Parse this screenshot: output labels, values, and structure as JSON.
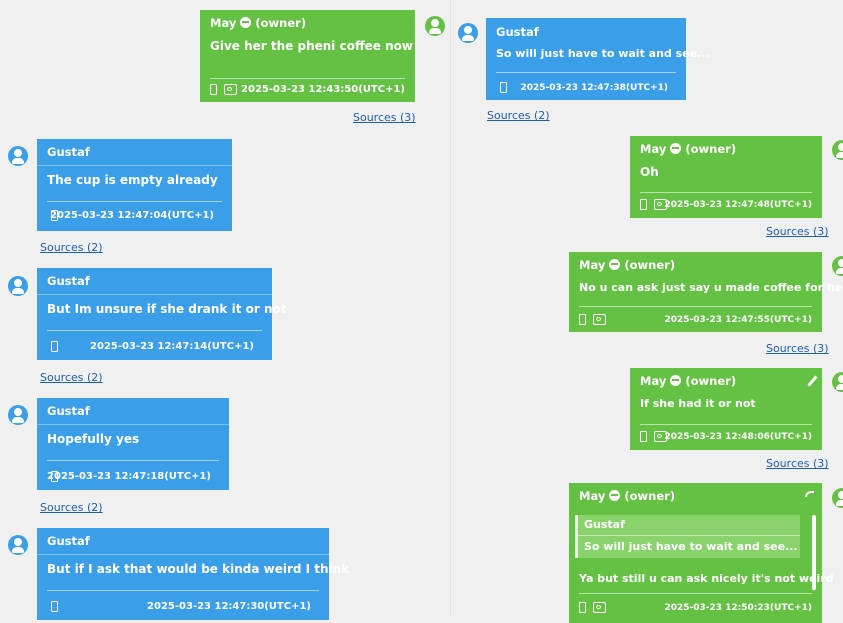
{
  "left": [
    {
      "id": "m1",
      "author": "May",
      "role": "(owner)",
      "text": "Give her the pheni coffee now",
      "timestamp": "2025-03-23 12:43:50(UTC+1)",
      "sources": "Sources (3)",
      "side": "right",
      "color": "green"
    },
    {
      "id": "m2",
      "author": "Gustaf",
      "text": "The cup is empty already",
      "timestamp": "2025-03-23 12:47:04(UTC+1)",
      "sources": "Sources (2)",
      "side": "left",
      "color": "blue"
    },
    {
      "id": "m3",
      "author": "Gustaf",
      "text": "But Im unsure if she drank it or not",
      "timestamp": "2025-03-23 12:47:14(UTC+1)",
      "sources": "Sources (2)",
      "side": "left",
      "color": "blue"
    },
    {
      "id": "m4",
      "author": "Gustaf",
      "text": "Hopefully yes",
      "timestamp": "2025-03-23 12:47:18(UTC+1)",
      "sources": "Sources (2)",
      "side": "left",
      "color": "blue"
    },
    {
      "id": "m5",
      "author": "Gustaf",
      "text": "But if I ask that would be kinda weird I think",
      "timestamp": "2025-03-23 12:47:30(UTC+1)",
      "side": "left",
      "color": "blue"
    }
  ],
  "right": [
    {
      "id": "r1",
      "author": "Gustaf",
      "text": "So will just have to wait and see...",
      "timestamp": "2025-03-23 12:47:38(UTC+1)",
      "sources": "Sources (2)",
      "color": "blue"
    },
    {
      "id": "r2",
      "author": "May",
      "role": "(owner)",
      "text": "Oh",
      "timestamp": "2025-03-23 12:47:48(UTC+1)",
      "sources": "Sources (3)",
      "color": "green"
    },
    {
      "id": "r3",
      "author": "May",
      "role": "(owner)",
      "text": "No u can ask just say u made coffee for her",
      "timestamp": "2025-03-23 12:47:55(UTC+1)",
      "sources": "Sources (3)",
      "color": "green"
    },
    {
      "id": "r4",
      "author": "May",
      "role": "(owner)",
      "text": "If she had it or not",
      "timestamp": "2025-03-23 12:48:06(UTC+1)",
      "sources": "Sources (3)",
      "color": "green"
    },
    {
      "id": "r5",
      "author": "May",
      "role": "(owner)",
      "quote_author": "Gustaf",
      "quote_text": "So will just have to wait and see...",
      "text": "Ya but still u can ask nicely it's not weird",
      "timestamp": "2025-03-23 12:50:23(UTC+1)",
      "color": "green"
    }
  ],
  "colors": {
    "blue": "#3a9ee8",
    "green": "#64c144",
    "link": "#1e5fae",
    "background": "#f0f0f0"
  }
}
